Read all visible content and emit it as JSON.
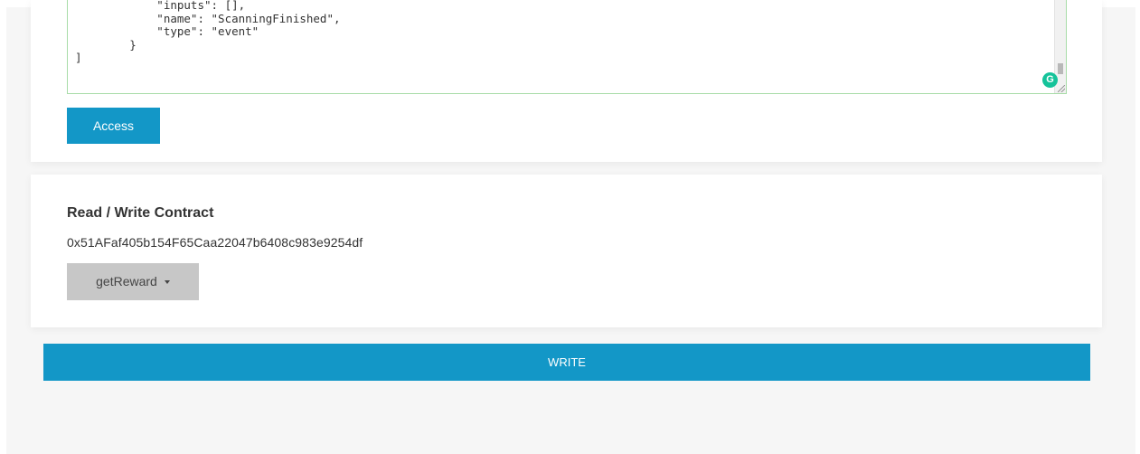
{
  "abi_editor": {
    "code": "            \"inputs\": [],\n            \"name\": \"ScanningFinished\",\n            \"type\": \"event\"\n        }\n]",
    "grammarly_icon": "G"
  },
  "access_button": {
    "label": "Access"
  },
  "read_write": {
    "title": "Read / Write Contract",
    "address": "0x51AFaf405b154F65Caa22047b6408c983e9254df",
    "function_select": {
      "selected": "getReward"
    }
  },
  "write_button": {
    "label": "WRITE"
  },
  "colors": {
    "primary": "#1397c7",
    "background": "#f6f6f6",
    "card": "#ffffff",
    "select_bg": "#c7c7c7",
    "textarea_border": "#a8dca8",
    "grammarly": "#15c39a"
  },
  "icons": {
    "grammarly": "grammarly-icon",
    "caret": "caret-down-icon",
    "resize": "resize-grip-icon"
  }
}
